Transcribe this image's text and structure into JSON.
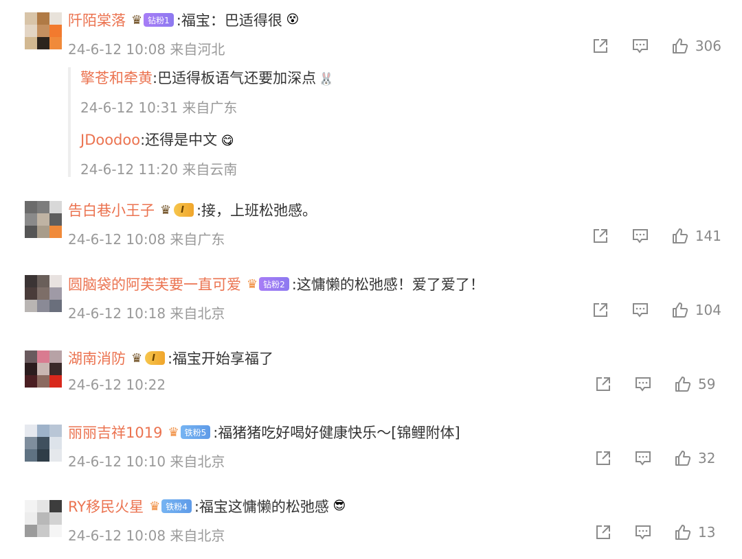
{
  "comments": [
    {
      "username": "阡陌棠落",
      "badge": "钻粉1",
      "text": ":福宝：巴适得很",
      "emoji": "😵",
      "meta": "24-6-12 10:08 来自河北",
      "likes": "306",
      "replies": [
        {
          "username": "擎苍和牵黄",
          "text": ":巴适得板语气还要加深点",
          "emoji": "🐰",
          "meta": "24-6-12 10:31 来自广东"
        },
        {
          "username": "JDoodoo",
          "text": ":还得是中文",
          "emoji": "😋",
          "meta": "24-6-12 11:20 来自云南"
        }
      ]
    },
    {
      "username": "告白巷小王子",
      "badge": "I",
      "text": ":接，上班松弛感。",
      "meta": "24-6-12 10:08 来自广东",
      "likes": "141"
    },
    {
      "username": "圆脑袋的阿芙芙要一直可爱",
      "badge": "钻粉2",
      "text": ":这慵懒的松弛感！爱了爱了！",
      "meta": "24-6-12 10:18 来自北京",
      "likes": "104"
    },
    {
      "username": "湖南消防",
      "badge": "I",
      "text": ":福宝开始享福了",
      "meta": "24-6-12 10:22",
      "likes": "59"
    },
    {
      "username": "丽丽吉祥1019",
      "badge": "铁粉5",
      "text": ":福猪猪吃好喝好健康快乐～[锦鲤附体]",
      "meta": "24-6-12 10:10 来自北京",
      "likes": "32"
    },
    {
      "username": "RY移民火星",
      "badge": "铁粉4",
      "text": ":福宝这慵懒的松弛感",
      "emoji": "😎",
      "meta": "24-6-12 10:08 来自北京",
      "likes": "13"
    }
  ],
  "icons": {
    "share": "share-icon",
    "comment": "comment-icon",
    "like": "thumbs-up-icon"
  },
  "colors": {
    "username": "#eb7350",
    "meta": "#999999",
    "text": "#333333"
  }
}
